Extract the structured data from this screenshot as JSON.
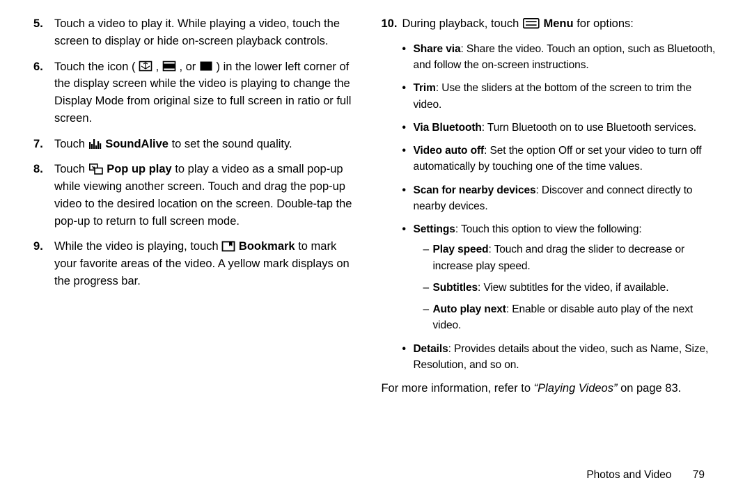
{
  "left": {
    "step5": "Touch a video to play it. While playing a video, touch the screen to display or hide on-screen playback controls.",
    "step6a": "Touch the icon (",
    "step6b": ",",
    "step6c": ", or",
    "step6d": ") in the lower left corner of the display screen while the video is playing to change the Display Mode from original size to full screen in ratio or full screen.",
    "step7a": "Touch",
    "step7_b": "SoundAlive",
    "step7c": " to set the sound quality.",
    "step8a": "Touch",
    "step8_b": "Pop up play",
    "step8c": " to play a video as a small pop-up while viewing another screen. Touch and drag the pop-up video to the desired location on the screen. Double-tap the pop-up to return to full screen mode.",
    "step9a": "While the video is playing, touch",
    "step9_b": "Bookmark",
    "step9c": " to mark your favorite areas of the video. A yellow mark displays on the progress bar."
  },
  "right": {
    "step10a": "During playback, touch",
    "step10_b": "Menu",
    "step10c": " for options:",
    "share_b": "Share via",
    "share": ": Share the video. Touch an option, such as Bluetooth, and follow the on-screen instructions.",
    "trim_b": "Trim",
    "trim": ": Use the sliders at the bottom of the screen to trim the video.",
    "viabt_b": "Via Bluetooth",
    "viabt": ": Turn Bluetooth on to use Bluetooth services.",
    "vao_b": "Video auto off",
    "vao": ": Set the option Off or set your video to turn off automatically by touching one of the time values.",
    "scan_b": "Scan for nearby devices",
    "scan": ": Discover and connect directly to nearby devices.",
    "settings_b": "Settings",
    "settings": ": Touch this option to view the following:",
    "play_b": "Play speed",
    "play": ": Touch and drag the slider to decrease or increase play speed.",
    "sub_b": "Subtitles",
    "sub": ": View subtitles for the video, if available.",
    "auto_b": "Auto play next",
    "auto": ": Enable or disable auto play of the next video.",
    "det_b": "Details",
    "det": ": Provides details about the video, such as Name, Size, Resolution, and so on.",
    "ref_a": "For more information, refer to ",
    "ref_i": "“Playing Videos”",
    "ref_b": " on page 83."
  },
  "footer": {
    "label": "Photos and Video",
    "pnum": "79"
  }
}
